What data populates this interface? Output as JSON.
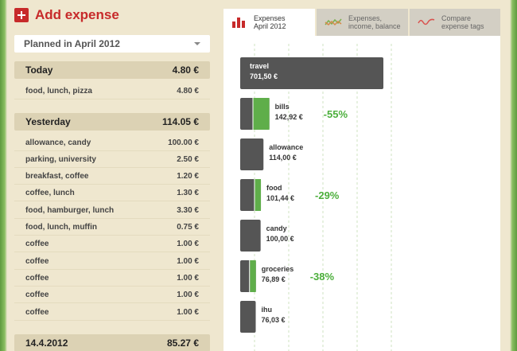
{
  "header": {
    "add_label": "Add expense"
  },
  "planned": {
    "label": "Planned in April 2012"
  },
  "groups": [
    {
      "title": "Today",
      "total": "4.80 €",
      "items": [
        {
          "name": "food, lunch, pizza",
          "amount": "4.80 €"
        }
      ]
    },
    {
      "title": "Yesterday",
      "total": "114.05 €",
      "items": [
        {
          "name": "allowance, candy",
          "amount": "100.00 €"
        },
        {
          "name": "parking, university",
          "amount": "2.50 €"
        },
        {
          "name": "breakfast, coffee",
          "amount": "1.20 €"
        },
        {
          "name": "coffee, lunch",
          "amount": "1.30 €"
        },
        {
          "name": "food, hamburger, lunch",
          "amount": "3.30 €"
        },
        {
          "name": "food, lunch, muffin",
          "amount": "0.75 €"
        },
        {
          "name": "coffee",
          "amount": "1.00 €"
        },
        {
          "name": "coffee",
          "amount": "1.00 €"
        },
        {
          "name": "coffee",
          "amount": "1.00 €"
        },
        {
          "name": "coffee",
          "amount": "1.00 €"
        },
        {
          "name": "coffee",
          "amount": "1.00 €"
        }
      ]
    },
    {
      "title": "14.4.2012",
      "total": "85.27 €",
      "items": []
    }
  ],
  "tabs": [
    {
      "line1": "Expenses",
      "line2": "April 2012",
      "icon": "bar-chart-icon"
    },
    {
      "line1": "Expenses,",
      "line2": "income, balance",
      "icon": "line-chart-icon"
    },
    {
      "line1": "Compare",
      "line2": "expense tags",
      "icon": "wave-chart-icon"
    }
  ],
  "colors": {
    "accent": "#c72a2a",
    "bar_dark": "#555555",
    "bar_green": "#5fae4a",
    "change_text": "#4caf3c",
    "header_bg": "#dcd2b4",
    "page_bg": "#efe7cf"
  },
  "chart_data": {
    "type": "bar",
    "orientation": "horizontal",
    "categories": [
      "travel",
      "bills",
      "allowance",
      "food",
      "candy",
      "groceries",
      "ihu"
    ],
    "values": [
      701.5,
      142.92,
      114.0,
      101.44,
      100.0,
      76.89,
      76.03
    ],
    "value_labels": [
      "701,50 €",
      "142,92 €",
      "114,00 €",
      "101,44 €",
      "100,00 €",
      "76,89 €",
      "76,03 €"
    ],
    "comparison_fraction": [
      null,
      0.55,
      null,
      0.29,
      null,
      0.38,
      null
    ],
    "changes": [
      "",
      "-55%",
      "",
      "-29%",
      "",
      "-38%",
      ""
    ],
    "grid": true
  }
}
